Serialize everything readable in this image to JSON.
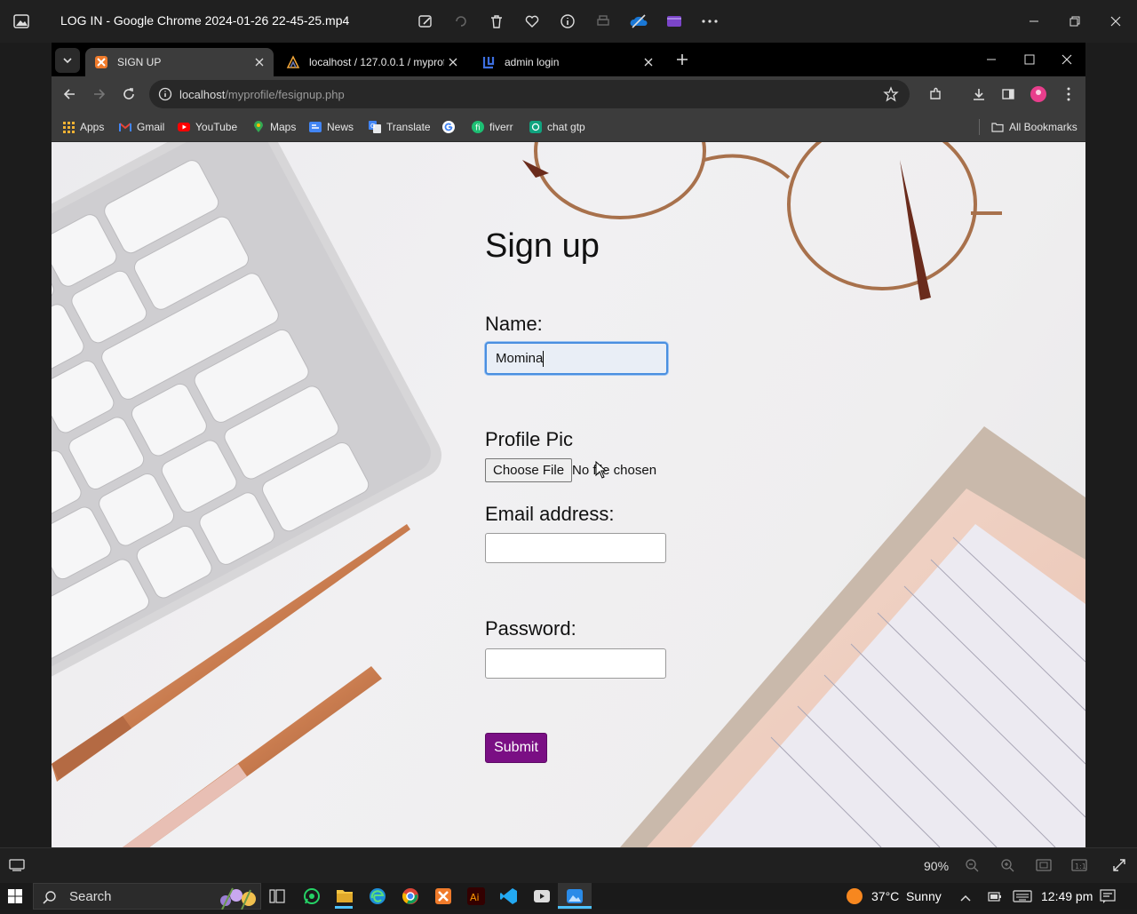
{
  "viewer": {
    "title": "LOG IN - Google Chrome 2024-01-26 22-45-25.mp4",
    "zoom": "90%"
  },
  "chrome": {
    "tabs": [
      {
        "label": "SIGN UP",
        "active": true
      },
      {
        "label": "localhost / 127.0.0.1 / myprof /",
        "active": false
      },
      {
        "label": "admin login",
        "active": false
      }
    ],
    "url_host": "localhost",
    "url_path": "/myprofile/fesignup.php",
    "bookmarks": [
      "Apps",
      "Gmail",
      "YouTube",
      "Maps",
      "News",
      "Translate",
      "fiverr",
      "chat gtp"
    ],
    "all_bookmarks": "All Bookmarks"
  },
  "page": {
    "heading": "Sign up",
    "name_label": "Name:",
    "name_value": "Momina",
    "profile_label": "Profile Pic",
    "choose_file": "Choose File",
    "no_file": "No file chosen",
    "email_label": "Email address:",
    "password_label": "Password:",
    "submit": "Submit"
  },
  "taskbar": {
    "search": "Search",
    "weather": "37°C  Sunny",
    "time": "12:49 pm"
  },
  "colors": {
    "submit_bg": "#7a0f84",
    "focus_border": "#4a8fe0"
  }
}
